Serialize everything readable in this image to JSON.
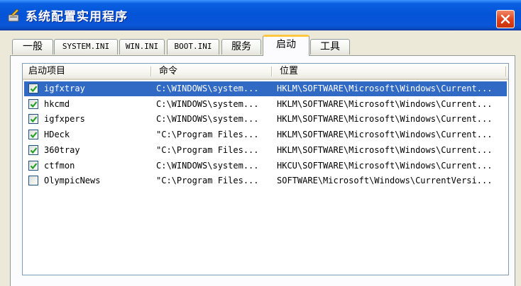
{
  "window": {
    "title": "系统配置实用程序"
  },
  "tabs": [
    {
      "label": "一般"
    },
    {
      "label": "SYSTEM.INI"
    },
    {
      "label": "WIN.INI"
    },
    {
      "label": "BOOT.INI"
    },
    {
      "label": "服务"
    },
    {
      "label": "启动",
      "active": true
    },
    {
      "label": "工具"
    }
  ],
  "startup": {
    "columns": [
      "启动项目",
      "命令",
      "位置"
    ],
    "rows": [
      {
        "item": "igfxtray",
        "command": "C:\\WINDOWS\\system...",
        "location": "HKLM\\SOFTWARE\\Microsoft\\Windows\\Current...",
        "checked": true,
        "selected": true
      },
      {
        "item": "hkcmd",
        "command": "C:\\WINDOWS\\system...",
        "location": "HKLM\\SOFTWARE\\Microsoft\\Windows\\Current...",
        "checked": true
      },
      {
        "item": "igfxpers",
        "command": "C:\\WINDOWS\\system...",
        "location": "HKLM\\SOFTWARE\\Microsoft\\Windows\\Current...",
        "checked": true
      },
      {
        "item": "HDeck",
        "command": "\"C:\\Program Files...",
        "location": "HKLM\\SOFTWARE\\Microsoft\\Windows\\Current...",
        "checked": true
      },
      {
        "item": "360tray",
        "command": "\"C:\\Program Files...",
        "location": "HKLM\\SOFTWARE\\Microsoft\\Windows\\Current...",
        "checked": true
      },
      {
        "item": "ctfmon",
        "command": "C:\\WINDOWS\\system...",
        "location": "HKCU\\SOFTWARE\\Microsoft\\Windows\\Current...",
        "checked": true
      },
      {
        "item": "OlympicNews",
        "command": "\"C:\\Program Files...",
        "location": "SOFTWARE\\Microsoft\\Windows\\CurrentVersi...",
        "checked": false
      }
    ]
  },
  "colors": {
    "title_blue": "#0453d8",
    "selection": "#316ac5",
    "active_tab_accent": "#ffc83c",
    "close_red": "#e0441e",
    "check_green": "#21a121"
  }
}
